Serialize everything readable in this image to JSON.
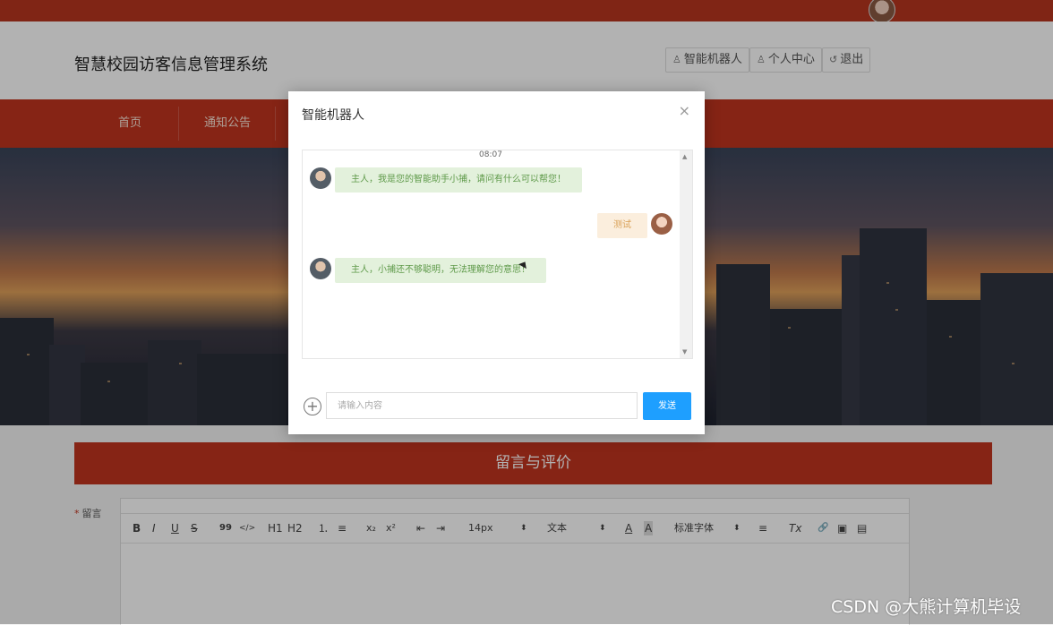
{
  "site": {
    "title": "智慧校园访客信息管理系统"
  },
  "header_buttons": {
    "robot": "智能机器人",
    "profile": "个人中心",
    "logout": "退出"
  },
  "nav": {
    "items": [
      "首页",
      "通知公告"
    ]
  },
  "section": {
    "title": "留言与评价"
  },
  "form": {
    "required_mark": "*",
    "message_label": "留言",
    "toolbar": {
      "bold": "B",
      "italic": "I",
      "underline": "U",
      "strike": "S",
      "quote": "99",
      "code": "</>",
      "h1": "H1",
      "h2": "H2",
      "ordered_list": "⒈",
      "bullet_list": "≡",
      "subscript": "x₂",
      "superscript": "x²",
      "outdent": "⇤",
      "indent": "⇥",
      "size": "14px",
      "block": "文本",
      "font_color": "A",
      "bg_color": "A",
      "font": "标准字体",
      "align": "≡",
      "clean": "Tx",
      "link": "🔗",
      "image": "▣",
      "video": "▤"
    }
  },
  "modal": {
    "title": "智能机器人",
    "close": "×",
    "timestamp": "08:07",
    "messages": [
      {
        "from": "bot",
        "text": "主人，我是您的智能助手小捕，请问有什么可以帮您！"
      },
      {
        "from": "user",
        "text": "测试"
      },
      {
        "from": "bot",
        "text": "主人，小捕还不够聪明，无法理解您的意思！"
      }
    ],
    "input_placeholder": "请输入内容",
    "send": "发送",
    "add": "+"
  },
  "watermark": "CSDN @大熊计算机毕设"
}
